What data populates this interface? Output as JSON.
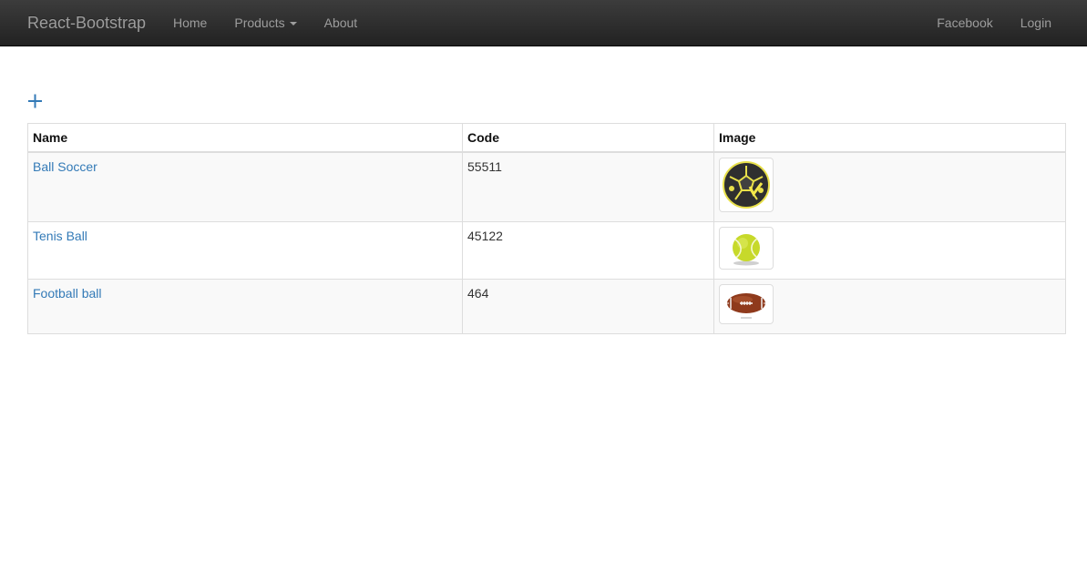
{
  "navbar": {
    "brand": "React-Bootstrap",
    "left_items": [
      {
        "label": "Home"
      },
      {
        "label": "Products"
      },
      {
        "label": "About"
      }
    ],
    "right_items": [
      {
        "label": "Facebook"
      },
      {
        "label": "Login"
      }
    ]
  },
  "toolbar": {
    "add_icon": "plus-icon",
    "accent_color": "#337ab7"
  },
  "table": {
    "headers": [
      "Name",
      "Code",
      "Image"
    ],
    "rows": [
      {
        "name": "Ball Soccer",
        "code": "55511",
        "image_icon": "soccer-ball-icon"
      },
      {
        "name": "Tenis Ball",
        "code": "45122",
        "image_icon": "tennis-ball-icon"
      },
      {
        "name": "Football ball",
        "code": "464",
        "image_icon": "american-football-icon"
      }
    ]
  },
  "colors": {
    "navbar_top": "#3c3c3c",
    "navbar_bottom": "#222222",
    "nav_text": "#9d9d9d",
    "link": "#337ab7",
    "row_stripe": "#f9f9f9",
    "border": "#dddddd"
  }
}
